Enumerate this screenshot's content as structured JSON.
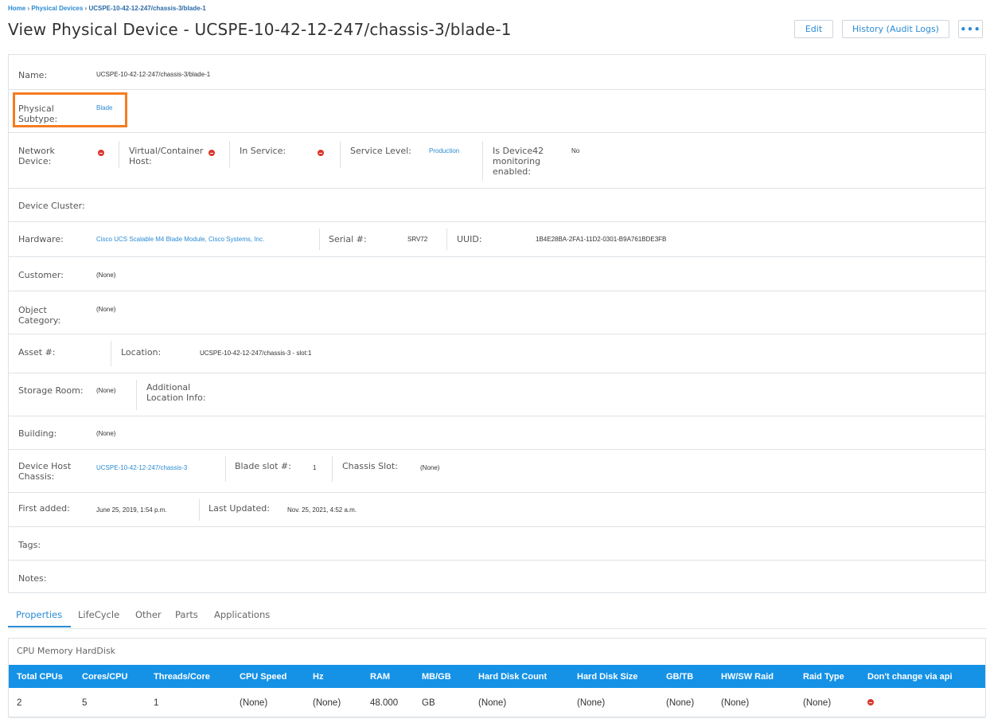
{
  "breadcrumb": {
    "home": "Home",
    "sep1": "›",
    "physical_devices": "Physical Devices",
    "sep2": "›",
    "current": "UCSPE-10-42-12-247/chassis-3/blade-1"
  },
  "title": "View Physical Device - UCSPE-10-42-12-247/chassis-3/blade-1",
  "header_buttons": {
    "edit": "Edit",
    "history": "History (Audit Logs)",
    "more": "•••"
  },
  "details": {
    "name": {
      "label": "Name:",
      "value": "UCSPE-10-42-12-247/chassis-3/blade-1"
    },
    "physical_subtype": {
      "label_1": "Physical",
      "label_2": "Subtype:",
      "value": "Blade"
    },
    "network_device": {
      "label_1": "Network",
      "label_2": "Device:",
      "value_icon": "no-icon"
    },
    "virtual_host": {
      "label_1": "Virtual/Container",
      "label_2": "Host:",
      "value_icon": "no-icon"
    },
    "in_service": {
      "label": "In Service:",
      "value_icon": "no-icon"
    },
    "service_level": {
      "label": "Service Level:",
      "value": "Production"
    },
    "monitoring": {
      "label_1": "Is Device42",
      "label_2": "monitoring",
      "label_3": "enabled:",
      "value": "No"
    },
    "device_cluster": {
      "label": "Device Cluster:"
    },
    "hardware": {
      "label": "Hardware:",
      "value": "Cisco UCS Scalable M4 Blade Module, Cisco Systems, Inc."
    },
    "serial": {
      "label": "Serial #:",
      "value": "SRV72"
    },
    "uuid": {
      "label": "UUID:",
      "value": "1B4E28BA-2FA1-11D2-0301-B9A761BDE3FB"
    },
    "customer": {
      "label": "Customer:",
      "value": "(None)"
    },
    "object_category": {
      "label_1": "Object",
      "label_2": "Category:",
      "value": "(None)"
    },
    "asset": {
      "label": "Asset #:"
    },
    "location": {
      "label": "Location:",
      "value": "UCSPE-10-42-12-247/chassis-3 - slot:1"
    },
    "storage_room": {
      "label": "Storage Room:",
      "value": "(None)"
    },
    "additional_location": {
      "label_1": "Additional",
      "label_2": "Location Info:"
    },
    "building": {
      "label": "Building:",
      "value": "(None)"
    },
    "device_host_chassis": {
      "label_1": "Device Host",
      "label_2": "Chassis:",
      "value": "UCSPE-10-42-12-247/chassis-3"
    },
    "blade_slot": {
      "label": "Blade slot #:",
      "value": "1"
    },
    "chassis_slot": {
      "label": "Chassis Slot:",
      "value": "(None)"
    },
    "first_added": {
      "label": "First added:",
      "value": "June 25, 2019, 1:54 p.m."
    },
    "last_updated": {
      "label": "Last Updated:",
      "value": "Nov. 25, 2021, 4:52 a.m."
    },
    "tags": {
      "label": "Tags:"
    },
    "notes": {
      "label": "Notes:"
    }
  },
  "tabs": [
    "Properties",
    "LifeCycle",
    "Other",
    "Parts",
    "Applications"
  ],
  "active_tab": "Properties",
  "cpu_section": {
    "title": "CPU Memory HardDisk",
    "columns": [
      "Total CPUs",
      "Cores/CPU",
      "Threads/Core",
      "CPU Speed",
      "Hz",
      "RAM",
      "MB/GB",
      "Hard Disk Count",
      "Hard Disk Size",
      "GB/TB",
      "HW/SW Raid",
      "Raid Type",
      "Don't change via api"
    ],
    "row": [
      "2",
      "5",
      "1",
      "(None)",
      "(None)",
      "48.000",
      "GB",
      "(None)",
      "(None)",
      "(None)",
      "(None)",
      "(None)",
      ""
    ],
    "row_last_icon": "no-icon"
  },
  "colors": {
    "accent": "#2a8bd4",
    "table_header": "#1592e6",
    "highlight": "#f57c1f",
    "no_icon": "#d9362b"
  }
}
